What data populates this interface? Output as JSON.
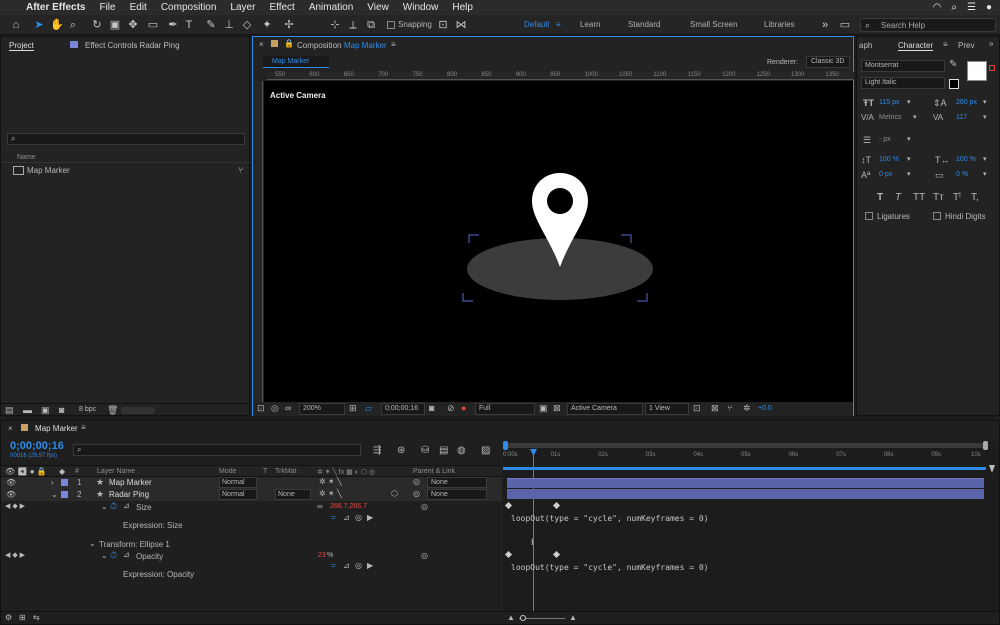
{
  "menubar": {
    "app": "After Effects",
    "items": [
      "File",
      "Edit",
      "Composition",
      "Layer",
      "Effect",
      "Animation",
      "View",
      "Window",
      "Help"
    ]
  },
  "toolbar": {
    "snapping": "Snapping",
    "workspaces": [
      "Default",
      "Learn",
      "Standard",
      "Small Screen",
      "Libraries"
    ],
    "search_placeholder": "Search Help"
  },
  "project": {
    "tab": "Project",
    "effect_tab": "Effect Controls Radar Ping",
    "name_col": "Name",
    "item": "Map Marker",
    "bpc": "8 bpc"
  },
  "comp": {
    "tab_prefix": "Composition",
    "tab_name": "Map Marker",
    "subtab": "Map Marker",
    "renderer_label": "Renderer:",
    "renderer": "Classic 3D",
    "view_label": "Active Camera",
    "ruler": [
      "550",
      "600",
      "650",
      "700",
      "750",
      "800",
      "850",
      "900",
      "950",
      "1000",
      "1050",
      "1100",
      "1150",
      "1200",
      "1250",
      "1300",
      "1350",
      "1400"
    ],
    "footer": {
      "zoom": "200%",
      "time": "0;00;00;16",
      "quality": "Full",
      "camera": "Active Camera",
      "views": "1 View",
      "exposure": "+0.0"
    }
  },
  "character": {
    "tabs": [
      "aph",
      "Character",
      "Prev"
    ],
    "font": "Montserrat",
    "style": "Light Italic",
    "size": "115 px",
    "leading": "260 px",
    "kerning": "Metrics",
    "tracking": "117",
    "stroke": "- px",
    "vscale": "100 %",
    "hscale": "100 %",
    "baseline": "0 px",
    "tsume": "0 %",
    "ligatures": "Ligatures",
    "hindi": "Hindi Digits"
  },
  "timeline": {
    "tab": "Map Marker",
    "timecode": "0;00;00;16",
    "fps": "00016 (29.97 fps)",
    "cols": {
      "num": "#",
      "name": "Layer Name",
      "mode": "Mode",
      "t": "T",
      "trkmat": "TrkMat",
      "parent": "Parent & Link"
    },
    "layers": [
      {
        "num": "1",
        "name": "Map Marker",
        "mode": "Normal",
        "trkmat": "",
        "parent": "None"
      },
      {
        "num": "2",
        "name": "Radar Ping",
        "mode": "Normal",
        "trkmat": "None",
        "parent": "None"
      }
    ],
    "size_label": "Size",
    "size_value": "266.7,266.7",
    "expr_size": "Expression: Size",
    "transform": "Transform: Ellipse 1",
    "opacity_label": "Opacity",
    "opacity_value": "23",
    "opacity_unit": "%",
    "expr_opacity": "Expression: Opacity",
    "code": "loopOut(type = \"cycle\", numKeyframes = 0)",
    "time_ticks": [
      "0:00s",
      "01s",
      "02s",
      "03s",
      "04s",
      "05s",
      "06s",
      "07s",
      "08s",
      "09s",
      "10s"
    ]
  },
  "colors": {
    "accent": "#2d8ceb",
    "bar": "#5b64a8",
    "label1": "#7b86d9"
  }
}
